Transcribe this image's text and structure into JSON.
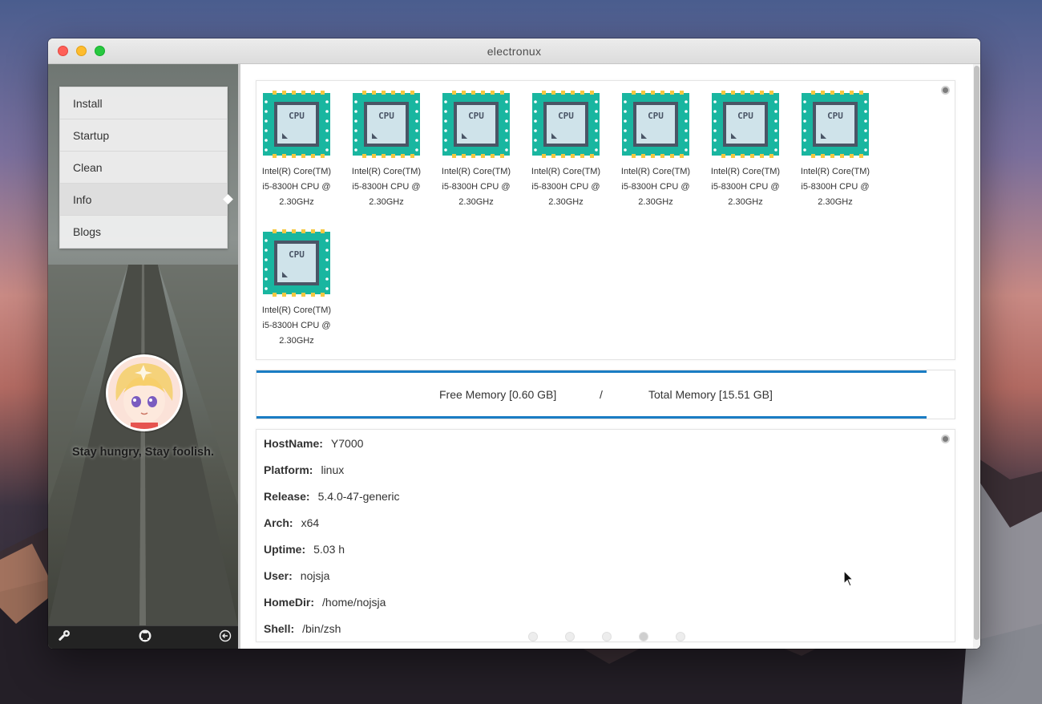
{
  "window": {
    "title": "electronux"
  },
  "sidebar": {
    "menu": [
      {
        "label": "Install"
      },
      {
        "label": "Startup"
      },
      {
        "label": "Clean"
      },
      {
        "label": "Info",
        "active": true
      },
      {
        "label": "Blogs"
      }
    ],
    "motto": "Stay hungry, Stay foolish.",
    "bottom_icons": [
      "wrench-icon",
      "github-icon",
      "logout-icon"
    ]
  },
  "cpus": {
    "count": 8,
    "icon_text": "CPU",
    "labels": [
      [
        "Intel(R) Core(TM)",
        "i5-8300H CPU @",
        "2.30GHz"
      ],
      [
        "Intel(R) Core(TM)",
        "i5-8300H CPU @",
        "2.30GHz"
      ],
      [
        "Intel(R) Core(TM)",
        "i5-8300H CPU @",
        "2.30GHz"
      ],
      [
        "Intel(R) Core(TM)",
        "i5-8300H CPU @",
        "2.30GHz"
      ],
      [
        "Intel(R) Core(TM)",
        "i5-8300H CPU @",
        "2.30GHz"
      ],
      [
        "Intel(R) Core(TM)",
        "i5-8300H CPU @",
        "2.30GHz"
      ],
      [
        "Intel(R) Core(TM)",
        "i5-8300H CPU @",
        "2.30GHz"
      ],
      [
        "Intel(R) Core(TM)",
        "i5-8300H CPU @",
        "2.30GHz"
      ]
    ]
  },
  "memory": {
    "free": "Free Memory [0.60 GB]",
    "separator": "/",
    "total": "Total Memory [15.51 GB]",
    "accent_color": "#1a7dc4"
  },
  "info": [
    {
      "key": "HostName:",
      "value": "Y7000"
    },
    {
      "key": "Platform:",
      "value": "linux"
    },
    {
      "key": "Release:",
      "value": "5.4.0-47-generic"
    },
    {
      "key": "Arch:",
      "value": "x64"
    },
    {
      "key": "Uptime:",
      "value": "5.03 h"
    },
    {
      "key": "User:",
      "value": "nojsja"
    },
    {
      "key": "HomeDir:",
      "value": "/home/nojsja"
    },
    {
      "key": "Shell:",
      "value": "/bin/zsh"
    }
  ],
  "pager": {
    "count": 5,
    "active_index": 3
  },
  "colors": {
    "cpu_teal": "#19b6a0",
    "cpu_pin": "#f5c842",
    "cpu_core": "#cfe3ea"
  }
}
